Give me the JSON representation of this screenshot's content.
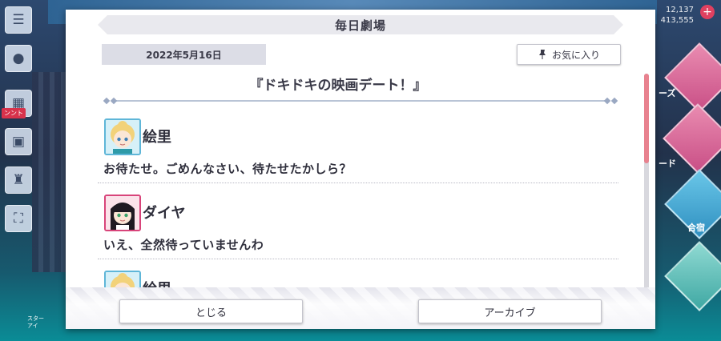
{
  "dialog": {
    "title": "毎日劇場",
    "date": "2022年5月16日",
    "favorite_label": "お気に入り",
    "story_title": "『ドキドキの映画デート！』",
    "entries": [
      {
        "speaker": "絵里",
        "avatar": "eli-avatar",
        "text": "お待たせ。ごめんなさい、待たせたかしら？"
      },
      {
        "speaker": "ダイヤ",
        "avatar": "dia-avatar",
        "text": "いえ、全然待っていませんわ"
      },
      {
        "speaker": "絵里",
        "avatar": "eli-avatar",
        "text": ""
      }
    ],
    "close_label": "とじる",
    "archive_label": "アーカイブ"
  },
  "background": {
    "counter_top": "12,137",
    "counter_bottom": "413,555",
    "event_badge": "ンント",
    "right_labels": {
      "a": "ーズ",
      "b": "ード",
      "c": "合宿"
    },
    "side_label": "スター\nアイ"
  },
  "colors": {
    "accent_pink": "#e8828f",
    "eli_frame": "#5fb6d8",
    "dia_frame": "#d8447a"
  }
}
